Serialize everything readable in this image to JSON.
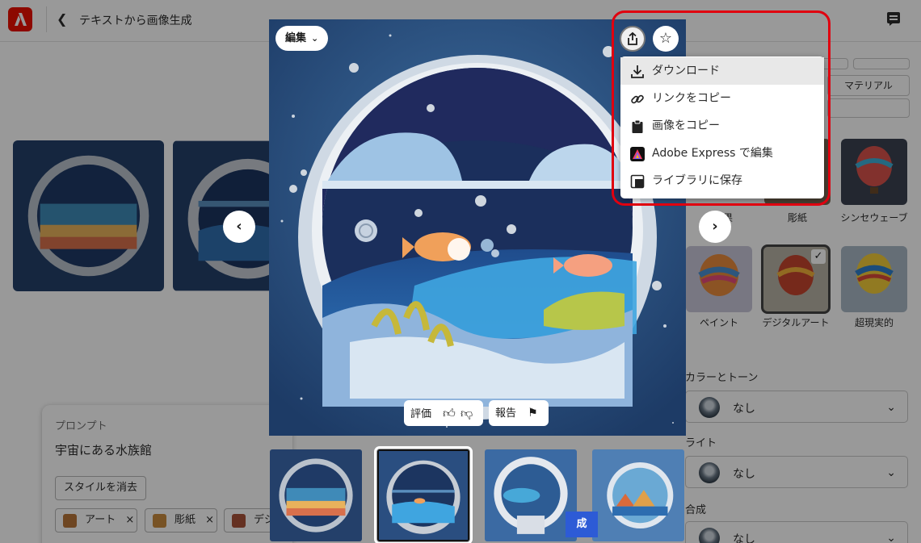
{
  "header": {
    "title": "テキストから画像生成"
  },
  "prompt_panel": {
    "label": "プロンプト",
    "text": "宇宙にある水族館",
    "clear_label": "スタイルを消去",
    "tags": [
      {
        "label": "アート"
      },
      {
        "label": "彫紙"
      },
      {
        "label": "デジ"
      }
    ],
    "tag_remove_glyph": "×"
  },
  "style_panel": {
    "tile_labels": [
      "効果",
      "彫紙",
      "シンセウェーブ",
      "ペイント",
      "デジタルアート",
      "超現実的"
    ],
    "material_label": "マテリアル",
    "color_tone_label": "カラーとトーン",
    "color_tone_value": "なし",
    "light_label": "ライト",
    "light_value": "なし",
    "composition_label": "合成",
    "composition_value": "なし"
  },
  "viewer": {
    "edit_label": "編集",
    "rate_label": "評価",
    "report_label": "報告",
    "edit_overlay_label": "成"
  },
  "share_menu": {
    "items": [
      {
        "label": "ダウンロード",
        "icon": "download-icon"
      },
      {
        "label": "リンクをコピー",
        "icon": "link-icon"
      },
      {
        "label": "画像をコピー",
        "icon": "clipboard-icon"
      },
      {
        "label": "Adobe Express で編集",
        "icon": "adobe-express-icon"
      },
      {
        "label": "ライブラリに保存",
        "icon": "library-icon"
      }
    ]
  },
  "colors": {
    "brand": "#eb1000",
    "highlight": "#e0000f",
    "dim_overlay": "rgba(0,0,0,0.4)"
  }
}
